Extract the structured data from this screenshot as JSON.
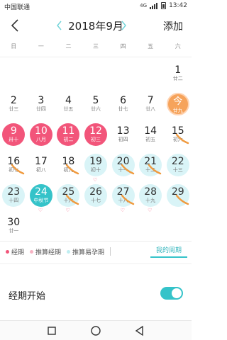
{
  "status_bar": {
    "carrier": "中国联通",
    "network": "4G",
    "time": "13:42"
  },
  "header": {
    "month_title": "2018年9月",
    "add_label": "添加"
  },
  "weekdays": [
    "日",
    "一",
    "二",
    "三",
    "四",
    "五",
    "六"
  ],
  "weeks": [
    [
      null,
      null,
      null,
      null,
      null,
      null,
      {
        "day": "1",
        "lunar": "廿二",
        "type": "normal"
      }
    ],
    [
      {
        "day": "2",
        "lunar": "廿三",
        "type": "normal"
      },
      {
        "day": "3",
        "lunar": "廿四",
        "type": "normal"
      },
      {
        "day": "4",
        "lunar": "廿五",
        "type": "normal"
      },
      {
        "day": "5",
        "lunar": "廿六",
        "type": "normal"
      },
      {
        "day": "6",
        "lunar": "廿七",
        "type": "normal"
      },
      {
        "day": "7",
        "lunar": "廿八",
        "type": "normal"
      },
      {
        "day": "今",
        "lunar": "廿九",
        "type": "today"
      }
    ],
    [
      {
        "day": "9",
        "lunar": "卅十",
        "type": "period"
      },
      {
        "day": "10",
        "lunar": "八月",
        "type": "period"
      },
      {
        "day": "11",
        "lunar": "初二",
        "type": "period"
      },
      {
        "day": "12",
        "lunar": "初三",
        "type": "period"
      },
      {
        "day": "13",
        "lunar": "初四",
        "type": "normal"
      },
      {
        "day": "14",
        "lunar": "初五",
        "type": "normal"
      },
      {
        "day": "15",
        "lunar": "初六",
        "type": "normal",
        "mark": true
      }
    ],
    [
      {
        "day": "16",
        "lunar": "初七",
        "type": "normal",
        "mark": true
      },
      {
        "day": "17",
        "lunar": "初八",
        "type": "normal"
      },
      {
        "day": "18",
        "lunar": "初九",
        "type": "normal",
        "mark": true
      },
      {
        "day": "19",
        "lunar": "初十",
        "type": "fert",
        "heart": true
      },
      {
        "day": "20",
        "lunar": "十一",
        "type": "fert",
        "mark": true
      },
      {
        "day": "21",
        "lunar": "十二",
        "type": "fert",
        "mark": true
      },
      {
        "day": "22",
        "lunar": "十三",
        "type": "fert"
      }
    ],
    [
      {
        "day": "23",
        "lunar": "十四",
        "type": "fert"
      },
      {
        "day": "24",
        "lunar": "中秋节",
        "type": "ovu",
        "heart": true
      },
      {
        "day": "25",
        "lunar": "十六",
        "type": "fert",
        "heart": true,
        "mark": true
      },
      {
        "day": "26",
        "lunar": "十七",
        "type": "fert"
      },
      {
        "day": "27",
        "lunar": "十八",
        "type": "fert",
        "heart": true,
        "mark": true
      },
      {
        "day": "28",
        "lunar": "十九",
        "type": "fert",
        "heart": true
      },
      {
        "day": "29",
        "lunar": "",
        "type": "fert",
        "mark": true
      }
    ],
    [
      {
        "day": "30",
        "lunar": "廿一",
        "type": "normal"
      },
      null,
      null,
      null,
      null,
      null,
      null
    ]
  ],
  "legend": {
    "period": "经期",
    "predicted_period": "推算经期",
    "predicted_fertile": "推算易孕期",
    "my_cycle": "我的周期"
  },
  "setting": {
    "label": "经期开始",
    "enabled": true
  },
  "colors": {
    "period": "#f2557a",
    "fertile": "#d9f4f7",
    "ovulation": "#35c3c9",
    "today": "#f6a35b",
    "mark": "#f09a3e"
  },
  "icons": {
    "back": "chevron-left-icon",
    "prev": "chevron-left-icon",
    "next": "chevron-right-icon",
    "nav_square": "square-icon",
    "nav_home": "circle-icon",
    "nav_back": "triangle-back-icon"
  }
}
